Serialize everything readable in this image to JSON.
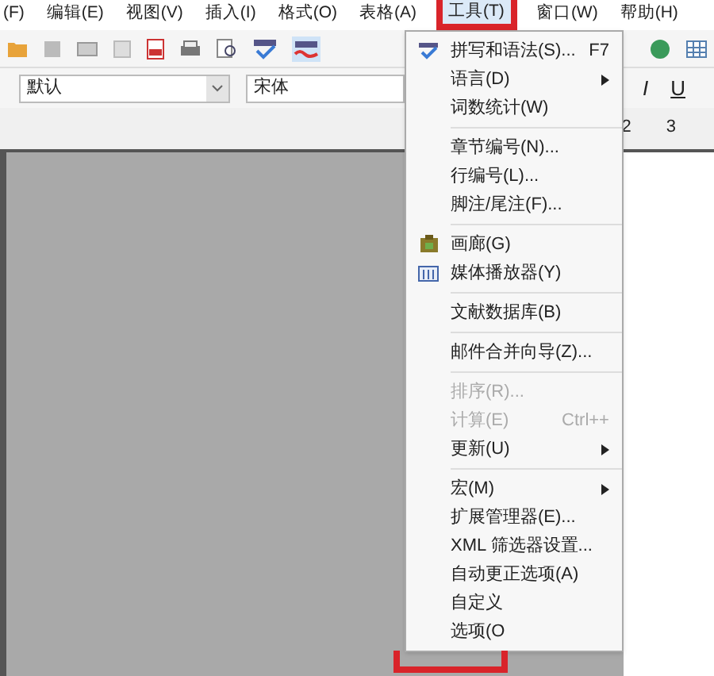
{
  "menu_bar": [
    {
      "label": "(F)",
      "selected": false
    },
    {
      "label": "编辑(E)",
      "selected": false
    },
    {
      "label": "视图(V)",
      "selected": false
    },
    {
      "label": "插入(I)",
      "selected": false
    },
    {
      "label": "格式(O)",
      "selected": false
    },
    {
      "label": "表格(A)",
      "selected": false
    },
    {
      "label": "工具(T)",
      "selected": true
    },
    {
      "label": "窗口(W)",
      "selected": false
    },
    {
      "label": "帮助(H)",
      "selected": false
    }
  ],
  "format_bar": {
    "style": "默认",
    "font": "宋体",
    "buttons": [
      "I",
      "U"
    ]
  },
  "ruler": [
    "2",
    "3"
  ],
  "tools_menu": [
    {
      "kind": "spelling",
      "label": "拼写和语法(S)...",
      "shortcut": "F7",
      "submenu": false,
      "disabled": false
    },
    {
      "kind": "item",
      "label": "语言(D)",
      "submenu": true,
      "disabled": false
    },
    {
      "kind": "item",
      "label": "词数统计(W)",
      "submenu": false,
      "disabled": false
    },
    {
      "kind": "separator"
    },
    {
      "kind": "item",
      "label": "章节编号(N)...",
      "submenu": false,
      "disabled": false
    },
    {
      "kind": "item",
      "label": "行编号(L)...",
      "submenu": false,
      "disabled": false
    },
    {
      "kind": "item",
      "label": "脚注/尾注(F)...",
      "submenu": false,
      "disabled": false
    },
    {
      "kind": "separator"
    },
    {
      "kind": "gallery",
      "label": "画廊(G)",
      "submenu": false,
      "disabled": false
    },
    {
      "kind": "media",
      "label": "媒体播放器(Y)",
      "submenu": false,
      "disabled": false
    },
    {
      "kind": "separator"
    },
    {
      "kind": "item",
      "label": "文献数据库(B)",
      "submenu": false,
      "disabled": false
    },
    {
      "kind": "separator"
    },
    {
      "kind": "item",
      "label": "邮件合并向导(Z)...",
      "submenu": false,
      "disabled": false
    },
    {
      "kind": "separator"
    },
    {
      "kind": "item",
      "label": "排序(R)...",
      "submenu": false,
      "disabled": true
    },
    {
      "kind": "item",
      "label": "计算(E)",
      "shortcut": "Ctrl++",
      "submenu": false,
      "disabled": true
    },
    {
      "kind": "item",
      "label": "更新(U)",
      "submenu": true,
      "disabled": false
    },
    {
      "kind": "separator"
    },
    {
      "kind": "item",
      "label": "宏(M)",
      "submenu": true,
      "disabled": false
    },
    {
      "kind": "item",
      "label": "扩展管理器(E)...",
      "submenu": false,
      "disabled": false
    },
    {
      "kind": "item",
      "label": "XML 筛选器设置...",
      "submenu": false,
      "disabled": false
    },
    {
      "kind": "item",
      "label": "自动更正选项(A)",
      "submenu": false,
      "disabled": false
    },
    {
      "kind": "item",
      "label": "自定义",
      "submenu": false,
      "disabled": false
    },
    {
      "kind": "item",
      "label": "选项(O",
      "submenu": false,
      "disabled": false
    }
  ]
}
